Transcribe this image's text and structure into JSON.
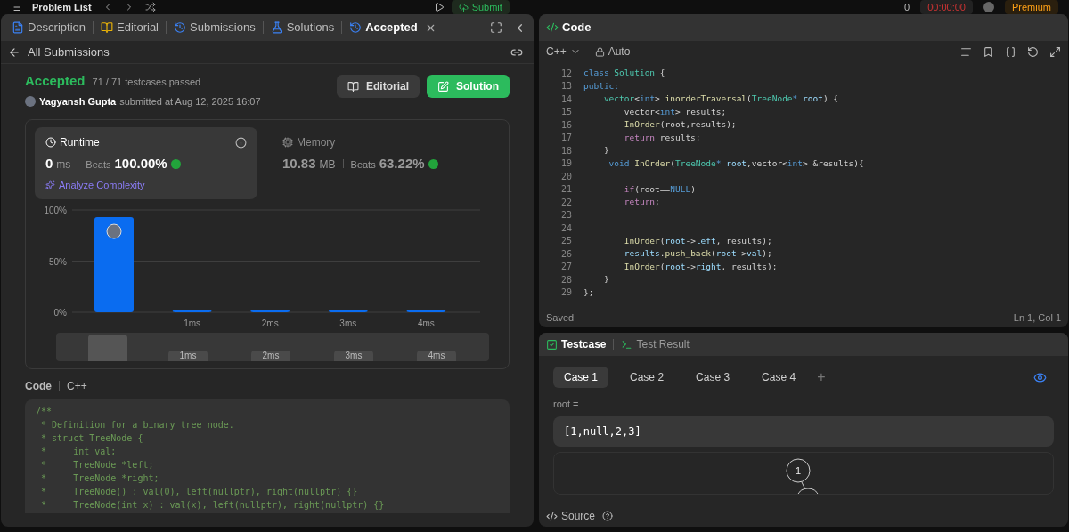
{
  "top_bar": {
    "problem_list": "Problem List",
    "submit": "Submit",
    "timer": "00:00:00",
    "streak": "0",
    "premium": "Premium"
  },
  "left_tabs": [
    {
      "label": "Description",
      "selected": false
    },
    {
      "label": "Editorial",
      "selected": false
    },
    {
      "label": "Submissions",
      "selected": false
    },
    {
      "label": "Solutions",
      "selected": false
    },
    {
      "label": "Accepted",
      "selected": true,
      "closable": true
    }
  ],
  "back_link": "All Submissions",
  "submission": {
    "status": "Accepted",
    "testcases": "71 / 71 testcases passed",
    "user": "Yagyansh Gupta",
    "submitted": "submitted at Aug 12, 2025 16:07",
    "buttons": [
      {
        "label": "Editorial",
        "kind": "secondary"
      },
      {
        "label": "Solution",
        "kind": "primary"
      }
    ]
  },
  "stats": [
    {
      "title": "Runtime",
      "value": "0",
      "unit": "ms",
      "beats_label": "Beats",
      "beats": "100.00%",
      "selected": true,
      "link": "Analyze Complexity"
    },
    {
      "title": "Memory",
      "value": "10.83",
      "unit": "MB",
      "beats_label": "Beats",
      "beats": "63.22%",
      "selected": false
    }
  ],
  "chart_data": {
    "type": "bar",
    "categories": [
      null,
      "1ms",
      "2ms",
      "3ms",
      "4ms"
    ],
    "values": [
      93,
      2,
      2,
      2,
      2
    ],
    "ylim": [
      0,
      100
    ],
    "yticks": [
      {
        "value": 0,
        "label": "0%"
      },
      {
        "value": 50,
        "label": "50%"
      },
      {
        "value": 100,
        "label": "100%"
      }
    ]
  },
  "navigator_labels": [
    "1ms",
    "2ms",
    "3ms",
    "4ms"
  ],
  "code_section": {
    "label": "Code",
    "language": "C++",
    "lines": [
      "/**",
      " * Definition for a binary tree node.",
      " * struct TreeNode {",
      " *     int val;",
      " *     TreeNode *left;",
      " *     TreeNode *right;",
      " *     TreeNode() : val(0), left(nullptr), right(nullptr) {}",
      " *     TreeNode(int x) : val(x), left(nullptr), right(nullptr) {}"
    ]
  },
  "editor": {
    "title": "Code",
    "language": "C++",
    "mode": "Auto",
    "status": "Saved",
    "cursor": "Ln 1, Col 1",
    "lines": [
      {
        "n": "12",
        "tokens": [
          {
            "kind": "kw",
            "text": "class "
          },
          {
            "kind": "type",
            "text": "Solution"
          },
          {
            "kind": "p",
            "text": " {"
          }
        ]
      },
      {
        "n": "13",
        "tokens": [
          {
            "kind": "kw",
            "text": "public:"
          }
        ]
      },
      {
        "n": "14",
        "tokens": [
          {
            "kind": "type",
            "text": "    vector"
          },
          {
            "kind": "p",
            "text": "<"
          },
          {
            "kind": "kw",
            "text": "int"
          },
          {
            "kind": "p",
            "text": "> "
          },
          {
            "kind": "fn",
            "text": "inorderTraversal"
          },
          {
            "kind": "p",
            "text": "("
          },
          {
            "kind": "type",
            "text": "TreeNode"
          },
          {
            "kind": "kw",
            "text": "*"
          },
          {
            "kind": "var",
            "text": " root"
          },
          {
            "kind": "p",
            "text": ") {"
          }
        ]
      },
      {
        "n": "15",
        "tokens": [
          {
            "kind": "p",
            "text": "        vector<"
          },
          {
            "kind": "kw",
            "text": "int"
          },
          {
            "kind": "p",
            "text": "> results;"
          }
        ]
      },
      {
        "n": "16",
        "tokens": [
          {
            "kind": "fn",
            "text": "        InOrder"
          },
          {
            "kind": "p",
            "text": "(root,results);"
          }
        ]
      },
      {
        "n": "17",
        "tokens": [
          {
            "kind": "ctrl",
            "text": "        return"
          },
          {
            "kind": "p",
            "text": " results;"
          }
        ]
      },
      {
        "n": "18",
        "tokens": [
          {
            "kind": "p",
            "text": "    }"
          }
        ]
      },
      {
        "n": "19",
        "tokens": [
          {
            "kind": "kw",
            "text": "     void "
          },
          {
            "kind": "fn",
            "text": "InOrder"
          },
          {
            "kind": "p",
            "text": "("
          },
          {
            "kind": "type",
            "text": "TreeNode"
          },
          {
            "kind": "kw",
            "text": "*"
          },
          {
            "kind": "var",
            "text": " root"
          },
          {
            "kind": "p",
            "text": ",vector<"
          },
          {
            "kind": "kw",
            "text": "int"
          },
          {
            "kind": "p",
            "text": "> &results){"
          }
        ]
      },
      {
        "n": "20"
      },
      {
        "n": "21",
        "tokens": [
          {
            "kind": "ctrl",
            "text": "        if"
          },
          {
            "kind": "p",
            "text": "(root=="
          },
          {
            "kind": "kw",
            "text": "NULL"
          },
          {
            "kind": "p",
            "text": ")"
          }
        ]
      },
      {
        "n": "22",
        "tokens": [
          {
            "kind": "ctrl",
            "text": "        return"
          },
          {
            "kind": "p",
            "text": ";"
          }
        ]
      },
      {
        "n": "23"
      },
      {
        "n": "24"
      },
      {
        "n": "25",
        "tokens": [
          {
            "kind": "fn",
            "text": "        InOrder"
          },
          {
            "kind": "p",
            "text": "("
          },
          {
            "kind": "var",
            "text": "root"
          },
          {
            "kind": "p",
            "text": "->"
          },
          {
            "kind": "var",
            "text": "left"
          },
          {
            "kind": "p",
            "text": ", results);"
          }
        ]
      },
      {
        "n": "26",
        "tokens": [
          {
            "kind": "var",
            "text": "        results"
          },
          {
            "kind": "p",
            "text": "."
          },
          {
            "kind": "fn",
            "text": "push_back"
          },
          {
            "kind": "p",
            "text": "("
          },
          {
            "kind": "var",
            "text": "root"
          },
          {
            "kind": "p",
            "text": "->"
          },
          {
            "kind": "var",
            "text": "val"
          },
          {
            "kind": "p",
            "text": ");"
          }
        ]
      },
      {
        "n": "27",
        "tokens": [
          {
            "kind": "fn",
            "text": "        InOrder"
          },
          {
            "kind": "p",
            "text": "("
          },
          {
            "kind": "var",
            "text": "root"
          },
          {
            "kind": "p",
            "text": "->"
          },
          {
            "kind": "var",
            "text": "right"
          },
          {
            "kind": "p",
            "text": ", results);"
          }
        ]
      },
      {
        "n": "28",
        "tokens": [
          {
            "kind": "p",
            "text": "    }"
          }
        ]
      },
      {
        "n": "29",
        "tokens": [
          {
            "kind": "p",
            "text": "};"
          }
        ]
      }
    ]
  },
  "test_tabs": [
    {
      "label": "Testcase",
      "selected": true
    },
    {
      "label": "Test Result",
      "selected": false
    }
  ],
  "cases": [
    {
      "label": "Case 1",
      "selected": true
    },
    {
      "label": "Case 2",
      "selected": false
    },
    {
      "label": "Case 3",
      "selected": false
    },
    {
      "label": "Case 4",
      "selected": false
    }
  ],
  "add_case": "+",
  "input": {
    "label": "root =",
    "value": "[1,null,2,3]"
  },
  "tree_root": "1",
  "source": "Source"
}
